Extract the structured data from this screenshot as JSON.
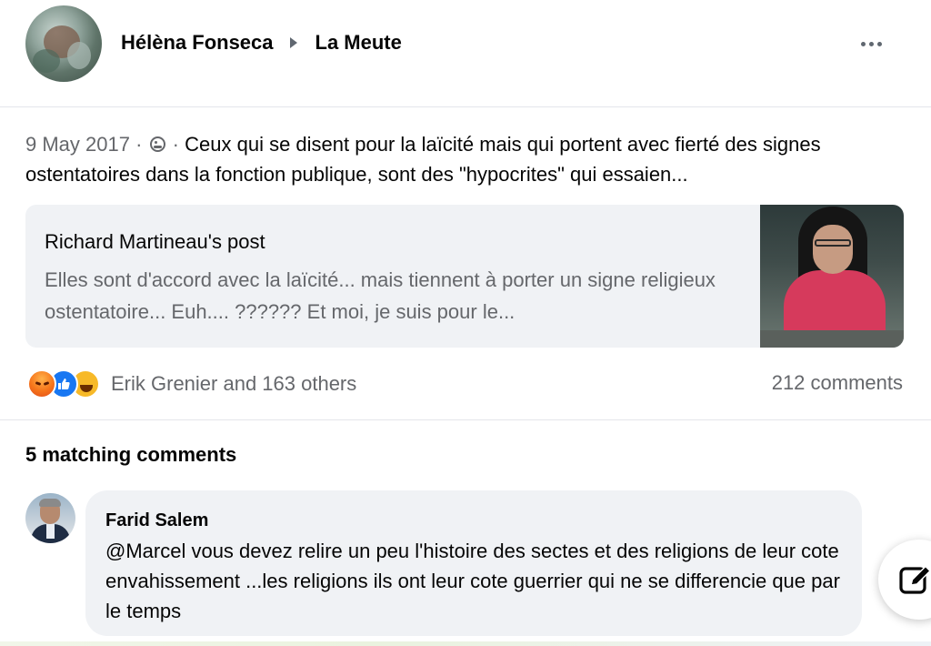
{
  "post": {
    "author": "Hélèna Fonseca",
    "group": "La Meute",
    "date": "9 May 2017",
    "separator": "·",
    "text": "Ceux qui se disent pour la laïcité mais qui portent avec fierté des signes ostentatoires dans la fonction publique, sont des \"hypocrites\" qui essaien...",
    "privacy_icon": "globe-icon",
    "more_icon": "more-options-icon"
  },
  "shared": {
    "title": "Richard Martineau's post",
    "excerpt": "Elles sont d'accord avec la laïcité... mais tiennent à porter un signe religieux ostentatoire... Euh.... ?????? Et moi, je suis pour le..."
  },
  "reactions": {
    "types": [
      "angry",
      "like",
      "haha"
    ],
    "names": "Erik Grenier and 163 others",
    "comments": "212 comments"
  },
  "comments_section": {
    "title": "5 matching comments",
    "items": [
      {
        "author": "Farid Salem",
        "text": "@Marcel vous devez relire un peu l'histoire des sectes et des religions de leur cote envahissement ...les religions ils ont leur cote guerrier qui ne se differencie que par le temps"
      }
    ]
  },
  "colors": {
    "text_primary": "#050505",
    "text_secondary": "#65676b",
    "bubble_bg": "#f0f2f5",
    "like_blue": "#1877f2",
    "divider": "#e4e6eb"
  }
}
